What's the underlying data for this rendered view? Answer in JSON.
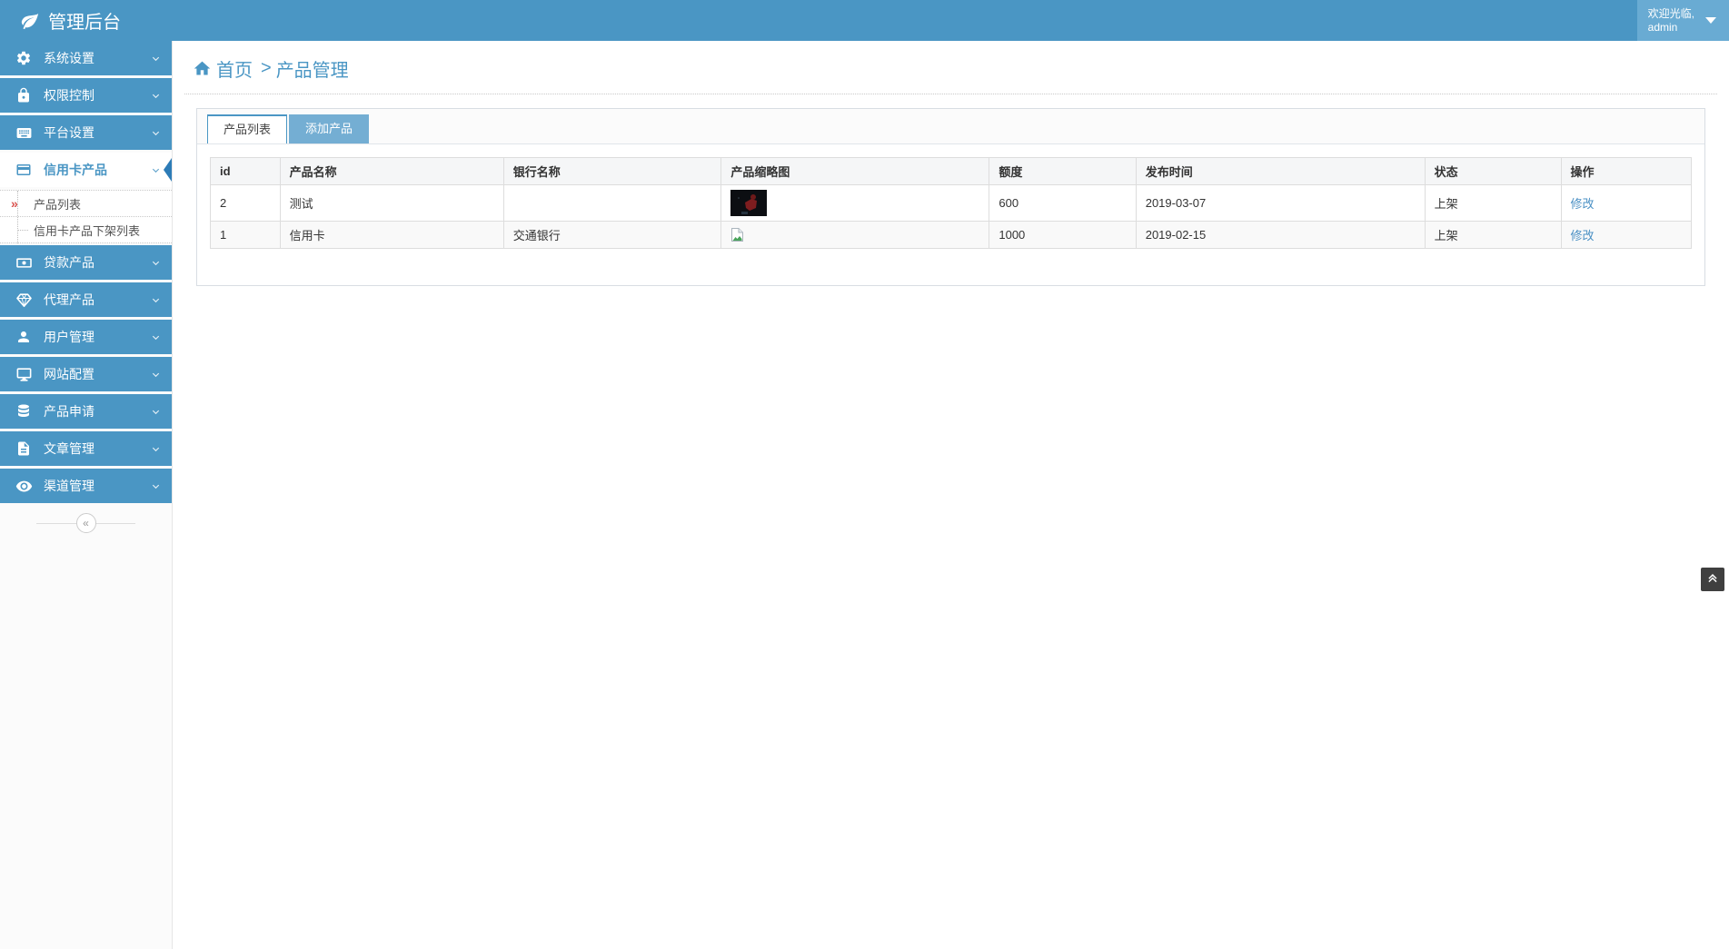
{
  "header": {
    "title": "管理后台",
    "logo_icon": "leaf-icon",
    "user": {
      "welcome": "欢迎光临,",
      "username": "admin",
      "caret_icon": "caret-down-icon"
    }
  },
  "sidebar": {
    "items": [
      {
        "label": "系统设置",
        "icon": "gear-icon"
      },
      {
        "label": "权限控制",
        "icon": "lock-icon"
      },
      {
        "label": "平台设置",
        "icon": "keyboard-icon"
      },
      {
        "label": "信用卡产品",
        "icon": "credit-card-icon",
        "active": true
      },
      {
        "label": "贷款产品",
        "icon": "money-icon"
      },
      {
        "label": "代理产品",
        "icon": "diamond-icon"
      },
      {
        "label": "用户管理",
        "icon": "user-icon"
      },
      {
        "label": "网站配置",
        "icon": "desktop-icon"
      },
      {
        "label": "产品申请",
        "icon": "database-icon"
      },
      {
        "label": "文章管理",
        "icon": "document-icon"
      },
      {
        "label": "渠道管理",
        "icon": "eye-icon"
      }
    ],
    "submenu": [
      {
        "label": "产品列表",
        "active": true,
        "marker": "»"
      },
      {
        "label": "信用卡产品下架列表",
        "active": false
      }
    ],
    "collapse_glyph": "«"
  },
  "breadcrumb": {
    "home_icon": "home-icon",
    "home": "首页",
    "separator": ">",
    "current": "产品管理"
  },
  "tabs": [
    {
      "label": "产品列表",
      "active": true
    },
    {
      "label": "添加产品",
      "active": false
    }
  ],
  "table": {
    "columns": [
      "id",
      "产品名称",
      "银行名称",
      "产品缩略图",
      "额度",
      "发布时间",
      "状态",
      "操作"
    ],
    "rows": [
      {
        "id": "2",
        "product_name": "测试",
        "bank_name": "",
        "thumbnail": "photo-thumbnail",
        "quota": "600",
        "publish_date": "2019-03-07",
        "status": "上架",
        "action_label": "修改"
      },
      {
        "id": "1",
        "product_name": "信用卡",
        "bank_name": "交通银行",
        "thumbnail": "broken-image",
        "quota": "1000",
        "publish_date": "2019-02-15",
        "status": "上架",
        "action_label": "修改"
      }
    ]
  },
  "back_to_top": {
    "icon": "angle-double-up-icon"
  },
  "colors": {
    "accent_blue": "#4a96c4",
    "user_box_blue": "#69abd3",
    "inactive_tab_blue": "#74aed3",
    "active_notch_blue": "#2d7cb7",
    "link_blue": "#4a90c4",
    "submenu_arrow_red": "#d9534f",
    "table_border": "#dddddd",
    "row_stripe": "#f9f9f9",
    "back_to_top_bg": "#3f3f3f"
  }
}
